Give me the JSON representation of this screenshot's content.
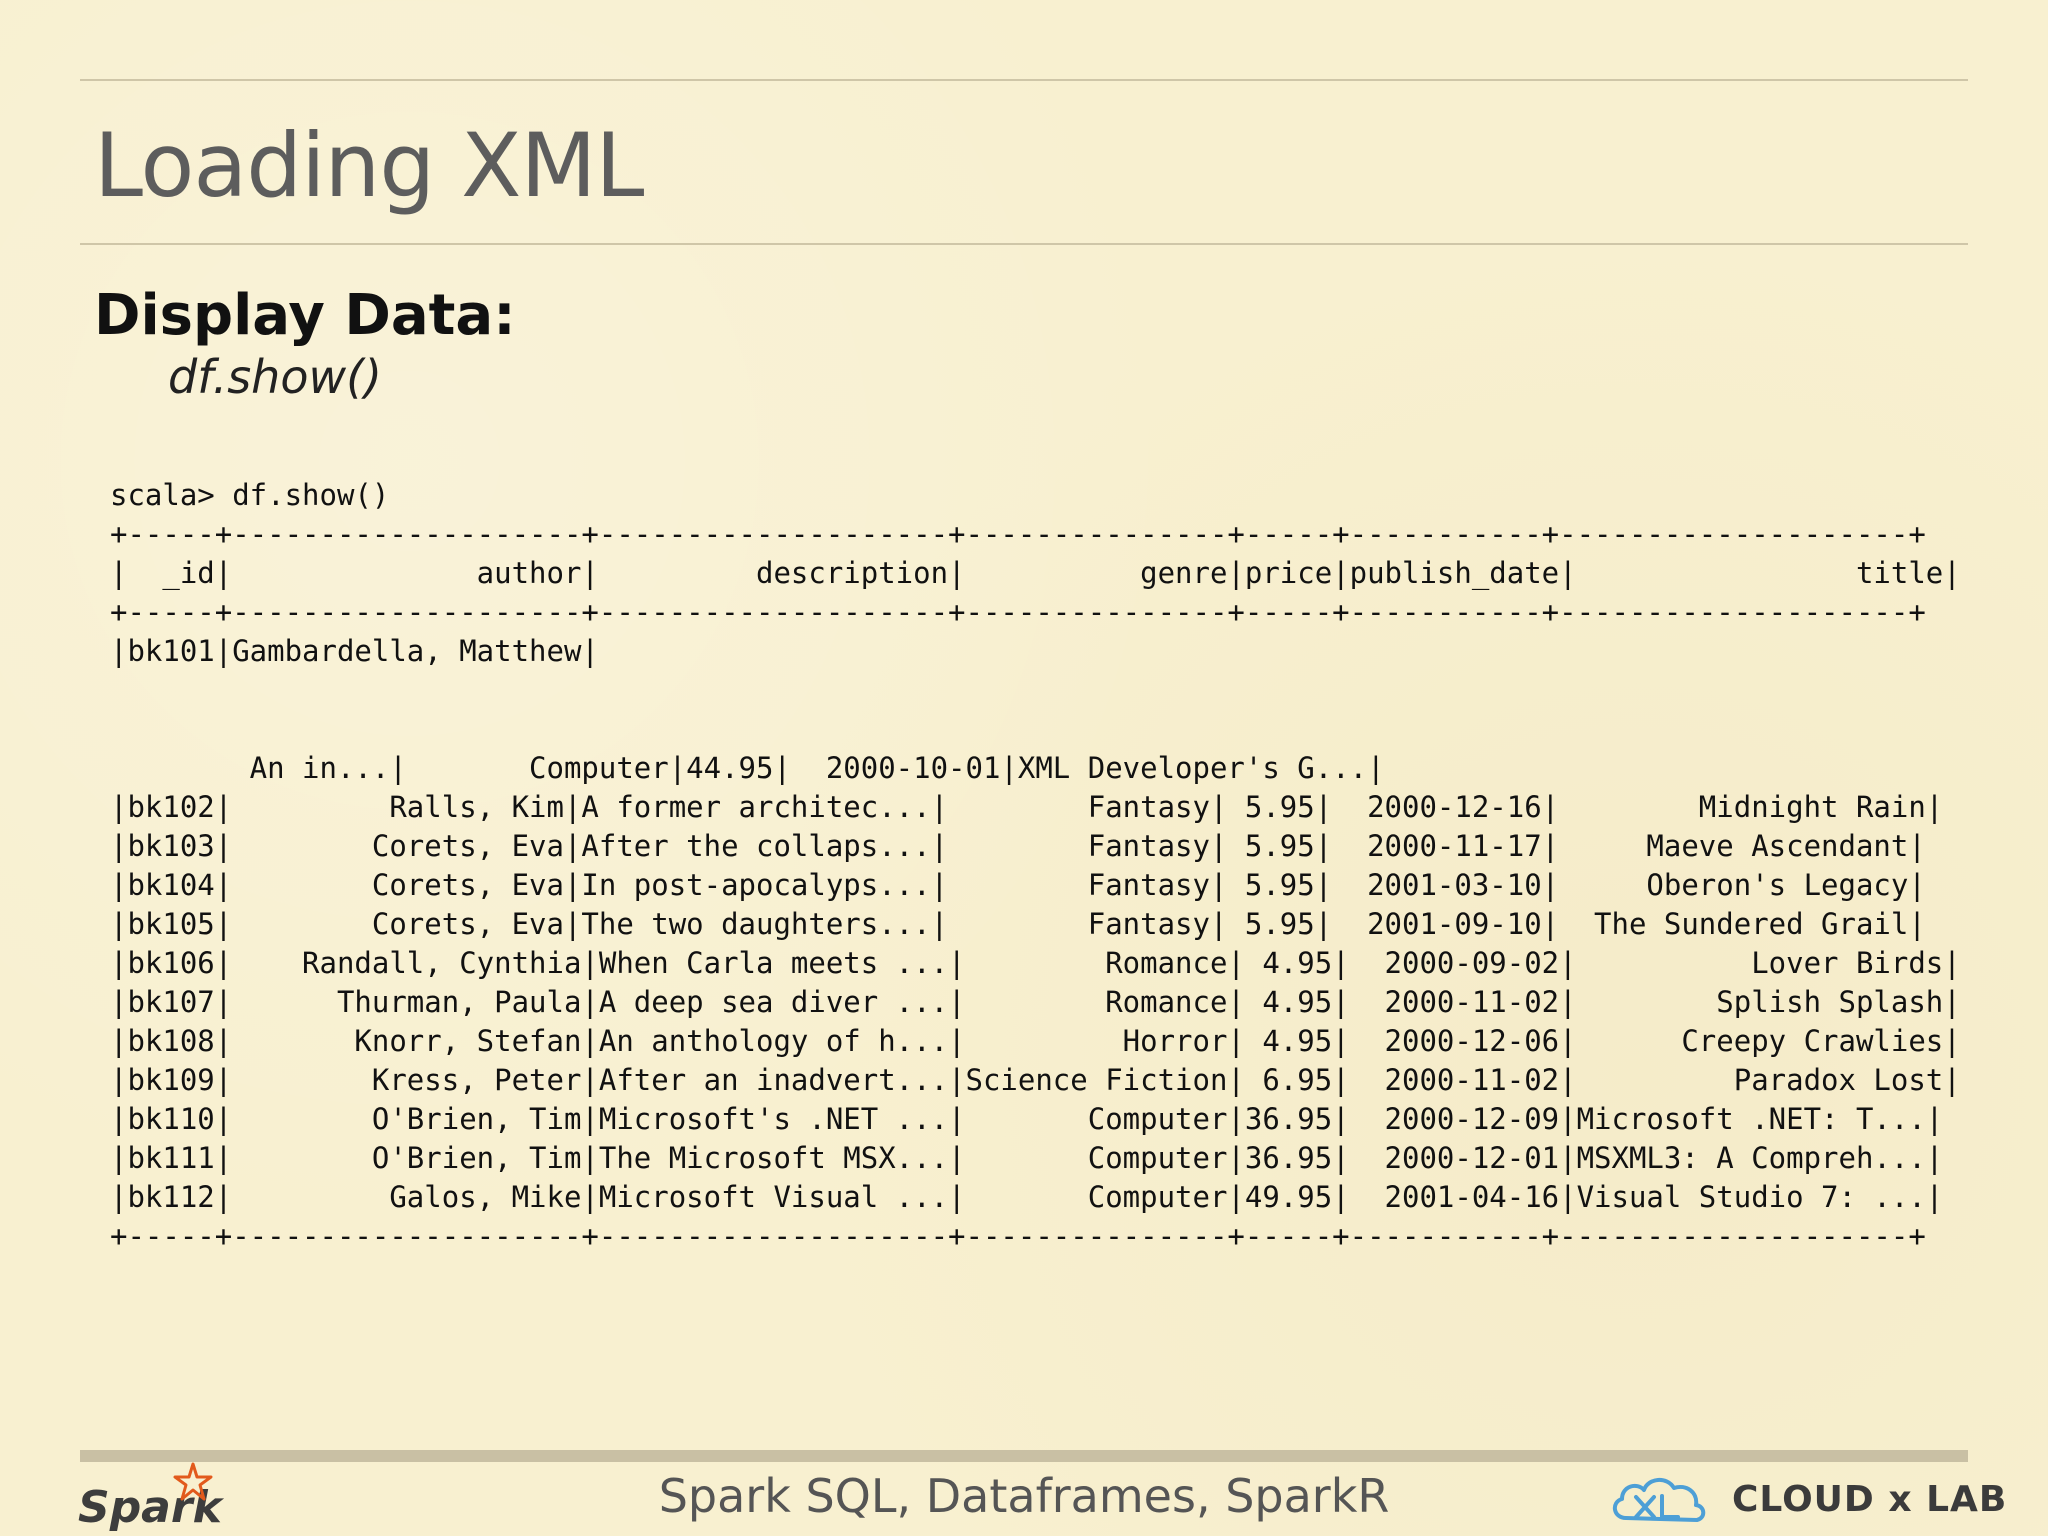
{
  "slide": {
    "title": "Loading XML",
    "subheading": "Display Data:",
    "code_hint": "df.show()"
  },
  "console": {
    "lines": [
      "scala> df.show()",
      "+-----+--------------------+--------------------+---------------+-----+-----------+--------------------+",
      "|  _id|              author|         description|          genre|price|publish_date|                title|",
      "+-----+--------------------+--------------------+---------------+-----+-----------+--------------------+",
      "|bk101|Gambardella, Matthew|",
      "",
      "",
      "        An in...|       Computer|44.95|  2000-10-01|XML Developer's G...|",
      "|bk102|         Ralls, Kim|A former architec...|        Fantasy| 5.95|  2000-12-16|        Midnight Rain|",
      "|bk103|        Corets, Eva|After the collaps...|        Fantasy| 5.95|  2000-11-17|     Maeve Ascendant|",
      "|bk104|        Corets, Eva|In post-apocalyps...|        Fantasy| 5.95|  2001-03-10|     Oberon's Legacy|",
      "|bk105|        Corets, Eva|The two daughters...|        Fantasy| 5.95|  2001-09-10|  The Sundered Grail|",
      "|bk106|    Randall, Cynthia|When Carla meets ...|        Romance| 4.95|  2000-09-02|          Lover Birds|",
      "|bk107|      Thurman, Paula|A deep sea diver ...|        Romance| 4.95|  2000-11-02|        Splish Splash|",
      "|bk108|       Knorr, Stefan|An anthology of h...|         Horror| 4.95|  2000-12-06|      Creepy Crawlies|",
      "|bk109|        Kress, Peter|After an inadvert...|Science Fiction| 6.95|  2000-11-02|         Paradox Lost|",
      "|bk110|        O'Brien, Tim|Microsoft's .NET ...|       Computer|36.95|  2000-12-09|Microsoft .NET: T...|",
      "|bk111|        O'Brien, Tim|The Microsoft MSX...|       Computer|36.95|  2000-12-01|MSXML3: A Compreh...|",
      "|bk112|         Galos, Mike|Microsoft Visual ...|       Computer|49.95|  2001-04-16|Visual Studio 7: ...|",
      "+-----+--------------------+--------------------+---------------+-----+-----------+--------------------+"
    ]
  },
  "footer": {
    "course_title": "Spark SQL, Dataframes, SparkR",
    "left_logo_text": "Spark",
    "right_logo_text": "CLOUD x LAB"
  },
  "colors": {
    "background": "#f8f0d0",
    "rule": "#cfc6a8",
    "title": "#5d5d5d",
    "spark_orange": "#e25a1c",
    "cloudxlab_blue": "#4d9fd6"
  }
}
